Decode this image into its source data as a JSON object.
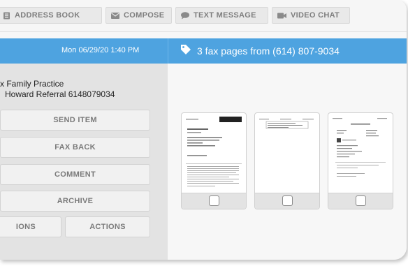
{
  "nav": {
    "address_book": "ADDRESS BOOK",
    "compose": "COMPOSE",
    "text_message": "TEXT MESSAGE",
    "video_chat": "VIDEO CHAT"
  },
  "header": {
    "datetime": "Mon 06/29/20 1:40 PM",
    "fax_summary": "3 fax pages from (614) 807-9034"
  },
  "sender": {
    "line1": "x Family Practice",
    "line2": "Howard Referral 6148079034"
  },
  "actions": {
    "send_item": "SEND ITEM",
    "fax_back": "FAX BACK",
    "comment": "COMMENT",
    "archive": "ARCHIVE",
    "options_partial": "IONS",
    "actions": "ACTIONS"
  },
  "pages": [
    {
      "label": "page-1"
    },
    {
      "label": "page-2"
    },
    {
      "label": "page-3"
    }
  ],
  "colors": {
    "accent": "#4ea3e0",
    "panel_left": "#e3e3e3",
    "button_text": "#7a7a7a"
  }
}
